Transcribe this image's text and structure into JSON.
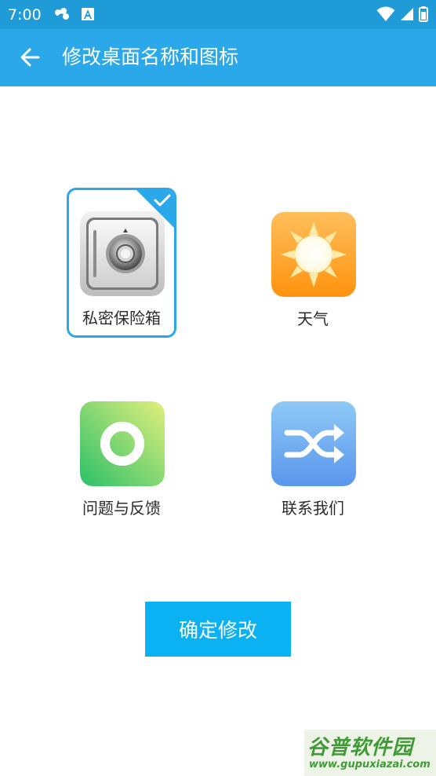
{
  "status_bar": {
    "time": "7:00"
  },
  "app_bar": {
    "title": "修改桌面名称和图标"
  },
  "options": [
    {
      "label": "私密保险箱",
      "icon": "safe-icon",
      "selected": true
    },
    {
      "label": "天气",
      "icon": "sun-icon",
      "selected": false
    },
    {
      "label": "问题与反馈",
      "icon": "ring-icon",
      "selected": false
    },
    {
      "label": "联系我们",
      "icon": "shuffle-icon",
      "selected": false
    }
  ],
  "confirm_button": {
    "label": "确定修改"
  },
  "watermark": {
    "name": "谷普软件园",
    "url": "www.gupuxiazai.com"
  },
  "colors": {
    "status_bar": "#1f9bd8",
    "app_bar": "#2aa8ea",
    "accent": "#2aa8ea",
    "confirm_button": "#0ab2f4",
    "label_text": "#2b2b2b"
  }
}
